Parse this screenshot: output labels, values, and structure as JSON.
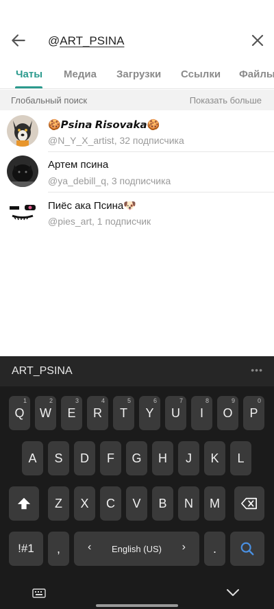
{
  "header": {
    "search_value_prefix": "@",
    "search_value_main": "ART_PSINA",
    "back_icon": "arrow-left-icon",
    "close_icon": "close-icon"
  },
  "tabs": [
    {
      "label": "Чаты",
      "active": true
    },
    {
      "label": "Медиа",
      "active": false
    },
    {
      "label": "Загрузки",
      "active": false
    },
    {
      "label": "Ссылки",
      "active": false
    },
    {
      "label": "Файлы",
      "active": false
    }
  ],
  "section": {
    "title": "Глобальный поиск",
    "show_more": "Показать больше"
  },
  "results": [
    {
      "name": "🍪𝙋𝙨𝙞𝙣𝙖 𝙍𝙞𝙨𝙤𝙫𝙖𝙠𝙖🍪",
      "subtitle": "@N_Y_X_artist, 32 подписчика"
    },
    {
      "name": "Артем псина",
      "subtitle": "@ya_debill_q, 3 подписчика"
    },
    {
      "name": "Пиёс ака Псина🐶",
      "subtitle": "@pies_art, 1 подписчик"
    }
  ],
  "keyboard": {
    "suggestion": "ART_PSINA",
    "row1": [
      {
        "key": "Q",
        "num": "1"
      },
      {
        "key": "W",
        "num": "2"
      },
      {
        "key": "E",
        "num": "3"
      },
      {
        "key": "R",
        "num": "4"
      },
      {
        "key": "T",
        "num": "5"
      },
      {
        "key": "Y",
        "num": "6"
      },
      {
        "key": "U",
        "num": "7"
      },
      {
        "key": "I",
        "num": "8"
      },
      {
        "key": "O",
        "num": "9"
      },
      {
        "key": "P",
        "num": "0"
      }
    ],
    "row2": [
      "A",
      "S",
      "D",
      "F",
      "G",
      "H",
      "J",
      "K",
      "L"
    ],
    "row3": [
      "Z",
      "X",
      "C",
      "V",
      "B",
      "N",
      "M"
    ],
    "symbols_label": "!#1",
    "comma_label": ",",
    "space_label": "English (US)",
    "period_label": ".",
    "colors": {
      "accent": "#2b9a8d",
      "search_key_icon": "#4a90e2",
      "keyboard_bg": "#1b1b1b",
      "key_bg": "#3a3a3a"
    }
  }
}
